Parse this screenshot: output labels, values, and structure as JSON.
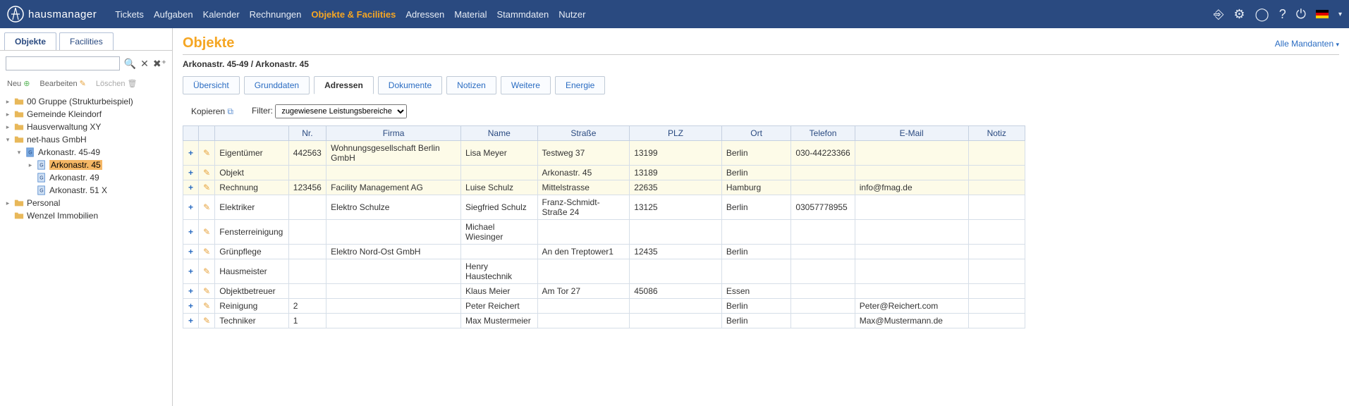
{
  "brand": "hausmanager",
  "nav": {
    "items": [
      "Tickets",
      "Aufgaben",
      "Kalender",
      "Rechnungen",
      "Objekte & Facilities",
      "Adressen",
      "Material",
      "Stammdaten",
      "Nutzer"
    ],
    "active_index": 4
  },
  "sidebar": {
    "tabs": [
      "Objekte",
      "Facilities"
    ],
    "active_tab": 0,
    "search_placeholder": "",
    "toolbar": {
      "neu": "Neu",
      "bearbeiten": "Bearbeiten",
      "loeschen": "Löschen"
    },
    "tree": [
      {
        "indent": 0,
        "expander": "right",
        "icon": "folder",
        "label": "00 Gruppe (Strukturbeispiel)"
      },
      {
        "indent": 0,
        "expander": "right",
        "icon": "folder",
        "label": "Gemeinde Kleindorf"
      },
      {
        "indent": 0,
        "expander": "right",
        "icon": "folder",
        "label": "Hausverwaltung XY"
      },
      {
        "indent": 0,
        "expander": "down",
        "icon": "folder",
        "label": "net-haus GmbH"
      },
      {
        "indent": 1,
        "expander": "down",
        "icon": "doc_b",
        "label": "Arkonastr. 45-49"
      },
      {
        "indent": 2,
        "expander": "right",
        "icon": "doc",
        "label": "Arkonastr. 45",
        "selected": true
      },
      {
        "indent": 2,
        "expander": "none",
        "icon": "doc",
        "label": "Arkonastr. 49"
      },
      {
        "indent": 2,
        "expander": "none",
        "icon": "doc",
        "label": "Arkonastr. 51 X"
      },
      {
        "indent": 0,
        "expander": "right",
        "icon": "folder",
        "label": "Personal"
      },
      {
        "indent": 0,
        "expander": "none",
        "icon": "folder",
        "label": "Wenzel Immobilien"
      }
    ]
  },
  "main": {
    "title": "Objekte",
    "mandant_label": "Alle Mandanten",
    "breadcrumb": "Arkonastr. 45-49 / Arkonastr. 45",
    "subtabs": [
      "Übersicht",
      "Grunddaten",
      "Adressen",
      "Dokumente",
      "Notizen",
      "Weitere",
      "Energie"
    ],
    "subtab_active": 2,
    "copy_label": "Kopieren",
    "filter_label": "Filter:",
    "filter_value": "zugewiesene Leistungsbereiche",
    "columns": [
      "",
      "",
      "",
      "Nr.",
      "Firma",
      "Name",
      "Straße",
      "PLZ",
      "Ort",
      "Telefon",
      "E-Mail",
      "Notiz"
    ],
    "rows": [
      {
        "hl": true,
        "role": "Eigentümer",
        "nr": "442563",
        "firma": "Wohnungsgesellschaft Berlin GmbH",
        "name": "Lisa Meyer",
        "str": "Testweg 37",
        "plz": "13199",
        "ort": "Berlin",
        "tel": "030-44223366",
        "mail": "",
        "notiz": ""
      },
      {
        "hl": true,
        "role": "Objekt",
        "nr": "",
        "firma": "",
        "name": "",
        "str": "Arkonastr. 45",
        "plz": "13189",
        "ort": "Berlin",
        "tel": "",
        "mail": "",
        "notiz": ""
      },
      {
        "hl": true,
        "role": "Rechnung",
        "nr": "123456",
        "firma": "Facility Management AG",
        "name": "Luise Schulz",
        "str": "Mittelstrasse",
        "plz": "22635",
        "ort": "Hamburg",
        "tel": "",
        "mail": "info@fmag.de",
        "notiz": ""
      },
      {
        "hl": false,
        "role": "Elektriker",
        "nr": "",
        "firma": "Elektro Schulze",
        "name": "Siegfried Schulz",
        "str": "Franz-Schmidt-Straße 24",
        "plz": "13125",
        "ort": "Berlin",
        "tel": "03057778955",
        "mail": "",
        "notiz": ""
      },
      {
        "hl": false,
        "role": "Fensterreinigung",
        "nr": "",
        "firma": "",
        "name": "Michael Wiesinger",
        "str": "",
        "plz": "",
        "ort": "",
        "tel": "",
        "mail": "",
        "notiz": ""
      },
      {
        "hl": false,
        "role": "Grünpflege",
        "nr": "",
        "firma": "Elektro Nord-Ost GmbH",
        "name": "",
        "str": "An den Treptower1",
        "plz": "12435",
        "ort": "Berlin",
        "tel": "",
        "mail": "",
        "notiz": ""
      },
      {
        "hl": false,
        "role": "Hausmeister",
        "nr": "",
        "firma": "",
        "name": "Henry Haustechnik",
        "str": "",
        "plz": "",
        "ort": "",
        "tel": "",
        "mail": "",
        "notiz": ""
      },
      {
        "hl": false,
        "role": "Objektbetreuer",
        "nr": "",
        "firma": "",
        "name": "Klaus Meier",
        "str": "Am Tor 27",
        "plz": "45086",
        "ort": "Essen",
        "tel": "",
        "mail": "",
        "notiz": ""
      },
      {
        "hl": false,
        "role": "Reinigung",
        "nr": "2",
        "firma": "",
        "name": "Peter Reichert",
        "str": "",
        "plz": "",
        "ort": "Berlin",
        "tel": "",
        "mail": "Peter@Reichert.com",
        "notiz": ""
      },
      {
        "hl": false,
        "role": "Techniker",
        "nr": "1",
        "firma": "",
        "name": "Max Mustermeier",
        "str": "",
        "plz": "",
        "ort": "Berlin",
        "tel": "",
        "mail": "Max@Mustermann.de",
        "notiz": ""
      }
    ]
  }
}
